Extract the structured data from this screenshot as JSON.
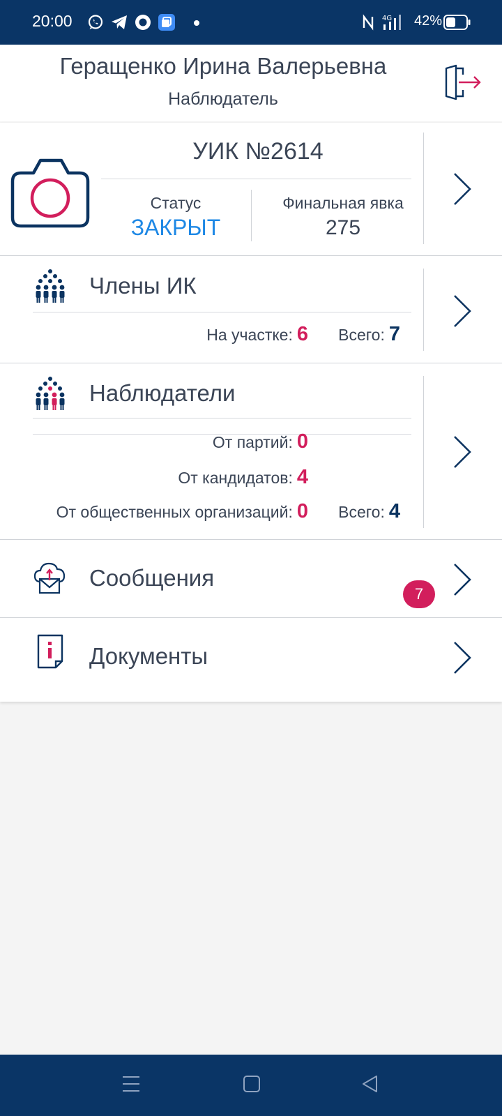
{
  "status_bar": {
    "time": "20:00",
    "network": "4G",
    "battery": "42%"
  },
  "header": {
    "name": "Геращенко Ирина Валерьевна",
    "role": "Наблюдатель"
  },
  "uik": {
    "title": "УИК №2614",
    "status_label": "Статус",
    "status_value": "ЗАКРЫТ",
    "turnout_label": "Финальная явка",
    "turnout_value": "275"
  },
  "members": {
    "title": "Члены ИК",
    "on_site_label": "На участке:",
    "on_site_value": "6",
    "total_label": "Всего:",
    "total_value": "7"
  },
  "observers": {
    "title": "Наблюдатели",
    "parties_label": "От партий:",
    "parties_value": "0",
    "candidates_label": "От кандидатов:",
    "candidates_value": "4",
    "orgs_label": "От общественных организаций:",
    "orgs_value": "0",
    "total_label": "Всего:",
    "total_value": "4"
  },
  "messages": {
    "title": "Сообщения",
    "badge": "7"
  },
  "documents": {
    "title": "Документы"
  },
  "colors": {
    "brand_navy": "#0a3566",
    "accent_red": "#d21e5c",
    "status_blue": "#1e88e5"
  },
  "icons": [
    "whatsapp-icon",
    "telegram-icon",
    "messenger-icon",
    "app-icon",
    "nfc-icon",
    "signal-icon",
    "battery-icon",
    "logout-icon",
    "camera-icon",
    "people-icon",
    "observers-icon",
    "cloud-mail-icon",
    "document-info-icon",
    "chevron-right-icon",
    "menu-icon",
    "home-icon",
    "back-icon"
  ]
}
